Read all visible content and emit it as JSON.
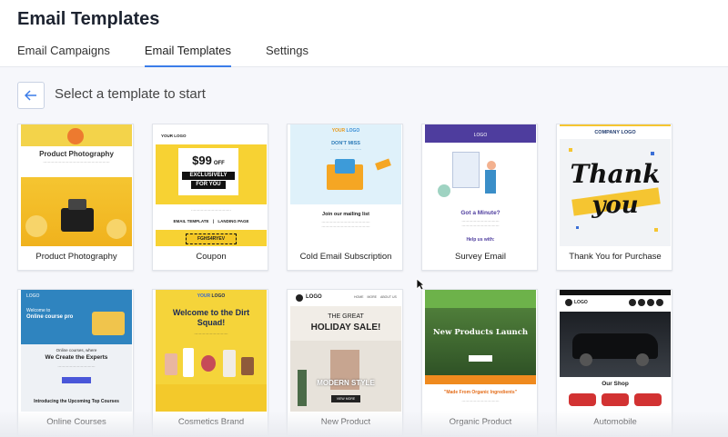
{
  "header": {
    "title": "Email Templates",
    "tabs": [
      {
        "label": "Email Campaigns",
        "active": false
      },
      {
        "label": "Email Templates",
        "active": true
      },
      {
        "label": "Settings",
        "active": false
      }
    ]
  },
  "page": {
    "subtitle": "Select a template to start"
  },
  "colors": {
    "accent": "#3b7de9"
  },
  "templates": [
    {
      "name": "Product Photography"
    },
    {
      "name": "Coupon"
    },
    {
      "name": "Cold Email Subscription"
    },
    {
      "name": "Survey Email"
    },
    {
      "name": "Thank You for Purchase"
    },
    {
      "name": "Online Courses"
    },
    {
      "name": "Cosmetics Brand"
    },
    {
      "name": "New Product"
    },
    {
      "name": "Organic Product"
    },
    {
      "name": "Automobile"
    }
  ],
  "thumbs": {
    "product_photography": {
      "title": "Product Photography"
    },
    "coupon": {
      "logo": "YOUR LOGO",
      "price": "$99",
      "off": "OFF",
      "line1": "EXCLUSIVELY",
      "line2": "FOR YOU",
      "footer_left": "EMAIL TEMPLATE",
      "footer_sep": "|",
      "footer_right": "LANDING PAGE",
      "code": "FGHS4RYEV"
    },
    "cold_email": {
      "logo_your": "YOUR",
      "logo": "LOGO",
      "headline": "DON'T MISS",
      "cta": "Join our mailing list"
    },
    "survey": {
      "logo": "LOGO",
      "headline": "Got a Minute?",
      "help": "Help us with:"
    },
    "thank_you": {
      "header": "COMPANY LOGO",
      "word1": "Thank",
      "word2": "you"
    },
    "online_courses": {
      "logo": "LOGO",
      "welcome": "Welcome to",
      "course": "Online course pro",
      "line1": "Online courses, where",
      "headline": "We Create the Experts",
      "footer": "Introducing the Upcoming Top Courses"
    },
    "cosmetics": {
      "logo_your": "YOUR",
      "logo": "LOGO",
      "headline": "Welcome to the Dirt Squad!"
    },
    "new_product": {
      "logo": "LOGO",
      "nav": [
        "HOME",
        "MORE",
        "ABOUT US"
      ],
      "line1": "THE GREAT",
      "line2": "HOLIDAY SALE!",
      "style": "MODERN STYLE",
      "btn": "VIEW MORE"
    },
    "organic": {
      "headline": "New Products Launch",
      "tagline": "\"Made From Organic Ingredients\""
    },
    "automobile": {
      "logo": "LOGO",
      "shop": "Our Shop"
    }
  }
}
